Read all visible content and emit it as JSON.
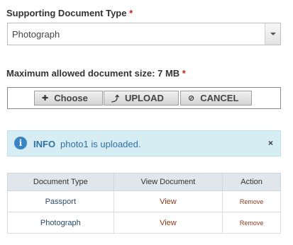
{
  "doc_type": {
    "label": "Supporting Document Type",
    "required_mark": "*",
    "selected_value": "Photograph"
  },
  "size_limit": {
    "label": "Maximum allowed document size: 7 MB",
    "required_mark": "*"
  },
  "upload": {
    "choose_label": "Choose",
    "upload_label": "UPLOAD",
    "cancel_label": "CANCEL"
  },
  "info_message": {
    "title": "INFO",
    "text": "photo1 is uploaded.",
    "close": "×"
  },
  "documents_table": {
    "headers": [
      "Document Type",
      "View Document",
      "Action"
    ],
    "rows": [
      {
        "type": "Passport",
        "view": "View",
        "action": "Remove"
      },
      {
        "type": "Photograph",
        "view": "View",
        "action": "Remove"
      }
    ]
  },
  "colors": {
    "required": "#cc1f1f",
    "info_bg": "#d7edf4",
    "info_text": "#2f6fa6",
    "link": "#8a3a1c"
  }
}
